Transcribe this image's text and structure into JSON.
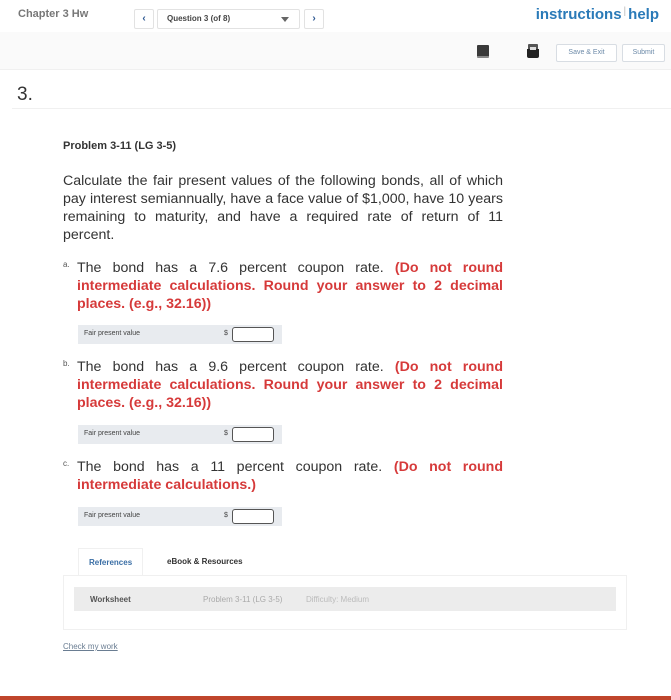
{
  "header": {
    "chapter_title": "Chapter 3 Hw",
    "links": {
      "instructions": "instructions",
      "help": "help",
      "separator": "|"
    }
  },
  "navigation": {
    "prev_icon": "‹",
    "next_icon": "›",
    "question_select": "Question 3 (of 8)",
    "icons": [
      "book-icon",
      "print-icon"
    ],
    "save_exit_label": "Save & Exit",
    "submit_label": "Submit"
  },
  "question": {
    "number": "3.",
    "problem_title": "Problem 3-11 (LG 3-5)",
    "intro": "Calculate the fair present values of the following bonds, all of which pay interest semiannually, have a face value of $1,000, have 10 years remaining to maturity, and have a required rate of return of 11 percent.",
    "parts": [
      {
        "letter": "a.",
        "text": "The bond has a 7.6 percent coupon rate. ",
        "instruction": "(Do not round intermediate calculations. Round your answer to 2 decimal places. (e.g., 32.16))",
        "answer_label": "Fair present value",
        "currency": "$",
        "answer_value": ""
      },
      {
        "letter": "b.",
        "text": "The bond has a 9.6 percent coupon rate. ",
        "instruction": "(Do not round intermediate calculations. Round your answer to 2 decimal places. (e.g., 32.16))",
        "answer_label": "Fair present value",
        "currency": "$",
        "answer_value": ""
      },
      {
        "letter": "c.",
        "text": "The bond has a 11 percent coupon rate. ",
        "instruction": "(Do not round intermediate calculations.)",
        "answer_label": "Fair present value",
        "currency": "$",
        "answer_value": ""
      }
    ]
  },
  "references": {
    "tabs": [
      "References",
      "eBook & Resources"
    ],
    "active_tab": "References",
    "row": {
      "type": "Worksheet",
      "problem": "Problem 3-11 (LG 3-5)",
      "difficulty": "Difficulty: Medium"
    }
  },
  "footer": {
    "check_my_work": "Check my work"
  },
  "colors": {
    "link_blue": "#2a7ab8",
    "instruction_red": "#d63a3a",
    "accent_bottom": "#c0452c"
  }
}
